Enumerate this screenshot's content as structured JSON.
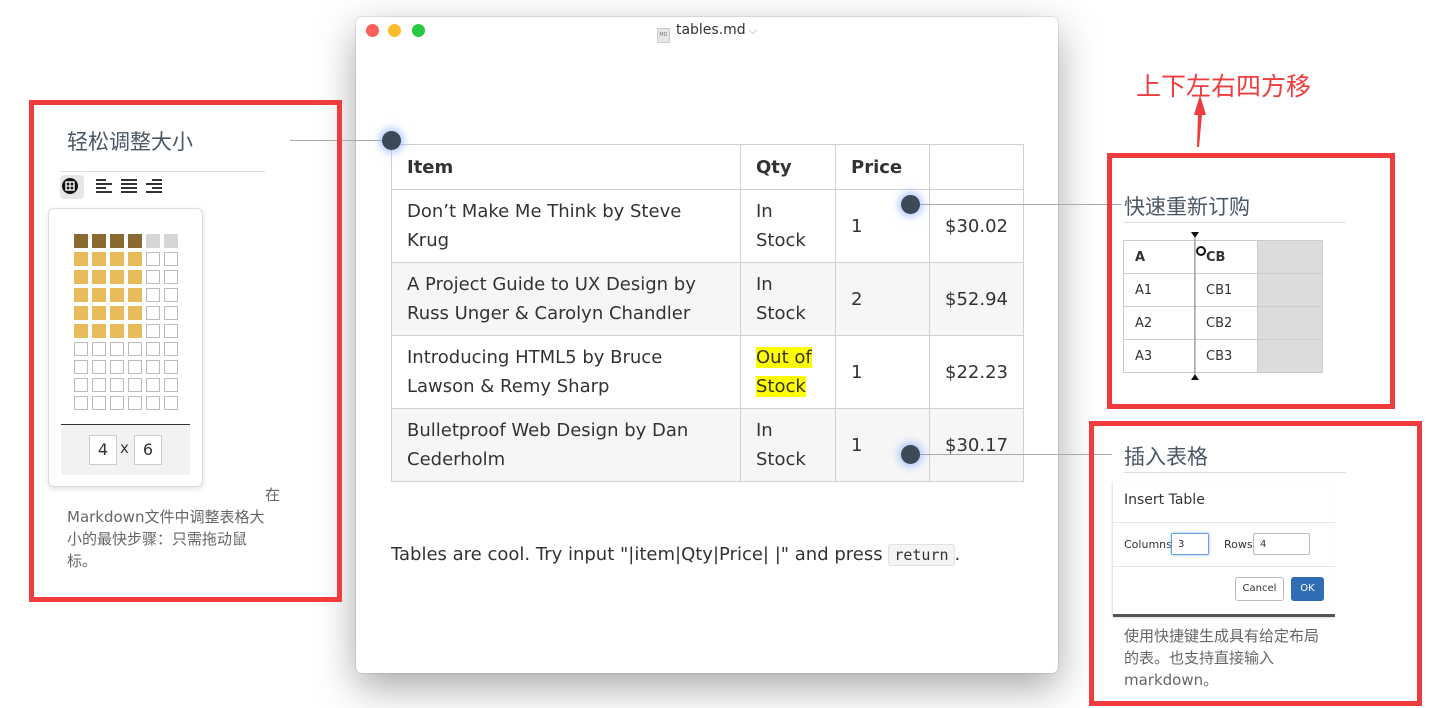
{
  "window": {
    "title": "tables.md",
    "file_badge": "MD"
  },
  "table": {
    "headers": [
      "Item",
      "Qty",
      "Price",
      ""
    ],
    "rows": [
      {
        "item": "Don’t Make Me Think by Steve Krug",
        "qty": "In Stock",
        "price": "1",
        "total": "$30.02"
      },
      {
        "item": "A Project Guide to UX Design by Russ Unger & Carolyn Chandler",
        "qty": "In Stock",
        "price": "2",
        "total": "$52.94"
      },
      {
        "item": "Introducing HTML5 by Bruce Lawson & Remy Sharp",
        "qty": "Out of Stock",
        "price": "1",
        "total": "$22.23"
      },
      {
        "item": "Bulletproof Web Design by Dan Cederholm",
        "qty": "In Stock",
        "price": "1",
        "total": "$30.17"
      }
    ]
  },
  "tip": {
    "text_before": "Tables are cool. Try input \"|item|Qty|Price| |\" and press ",
    "key": "return",
    "text_after": "."
  },
  "resize_panel": {
    "title": "轻松调整大小",
    "cols_value": "4",
    "times": "x",
    "rows_value": "6",
    "desc_line1": "在",
    "desc_line2": "Markdown文件中调整表格大",
    "desc_line3": "小的最快步骤：只需拖动鼠",
    "desc_line4": "标。"
  },
  "move_panel": {
    "arrow_label": "上下左右四方移",
    "title": "快速重新订购",
    "col_a_header": "A",
    "col_b_header": "CB",
    "col_a_cells": [
      "A1",
      "A2",
      "A3"
    ],
    "col_b_cells": [
      "CB1",
      "CB2",
      "CB3"
    ]
  },
  "insert_panel": {
    "title": "插入表格",
    "dialog_title": "Insert Table",
    "columns_label": "Columns",
    "columns_value": "3",
    "rows_label": "Rows",
    "rows_value": "4",
    "cancel_label": "Cancel",
    "ok_label": "OK",
    "desc_line1": "使用快捷键生成具有给定布局",
    "desc_line2": "的表。也支持直接输入",
    "desc_line3": "markdown。"
  },
  "colors": {
    "frame_red": "#f03c3c",
    "highlight": "#ffff00",
    "picker_selected": "#e8bb5b",
    "picker_header": "#8a6a32",
    "ok_blue": "#2f6db5",
    "dot": "#3c4a58"
  }
}
